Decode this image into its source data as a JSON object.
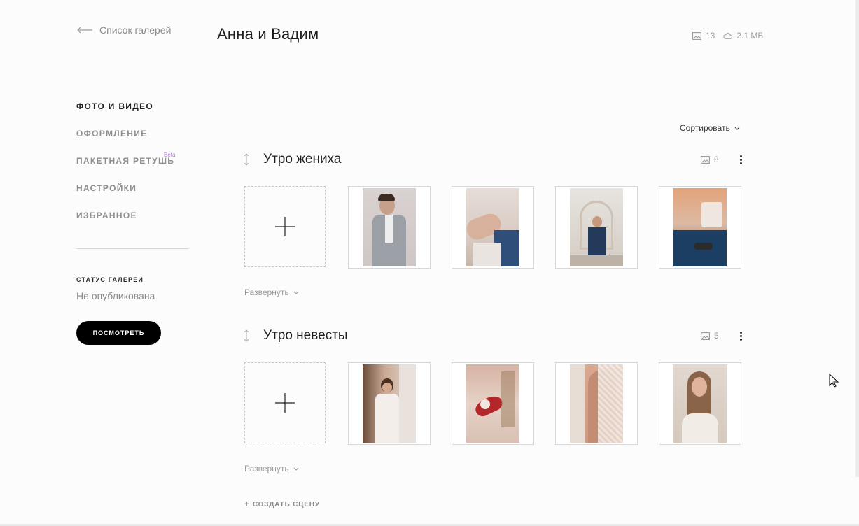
{
  "header": {
    "back_label": "Список галерей",
    "title": "Анна и Вадим",
    "photo_count": "13",
    "storage": "2.1 МБ"
  },
  "nav": {
    "items": [
      {
        "label": "ФОТО И ВИДЕО",
        "active": true
      },
      {
        "label": "ОФОРМЛЕНИЕ"
      },
      {
        "label": "ПАКЕТНАЯ РЕТУШЬ",
        "badge": "Beta"
      },
      {
        "label": "НАСТРОЙКИ"
      },
      {
        "label": "ИЗБРАННОЕ"
      }
    ]
  },
  "status": {
    "label": "СТАТУС ГАЛЕРЕИ",
    "value": "Не опубликована",
    "view_button": "ПОСМОТРЕТЬ"
  },
  "sort_label": "Сортировать",
  "scenes": [
    {
      "title": "Утро жениха",
      "count": "8",
      "expand_label": "Развернуть"
    },
    {
      "title": "Утро невесты",
      "count": "5",
      "expand_label": "Развернуть"
    }
  ],
  "create_scene_label": "СОЗДАТЬ СЦЕНУ",
  "colors": {
    "background": "#fcfcfc",
    "button_bg": "#000000",
    "beta_badge": "#b07bd6",
    "muted_text": "#8a8a8a"
  }
}
